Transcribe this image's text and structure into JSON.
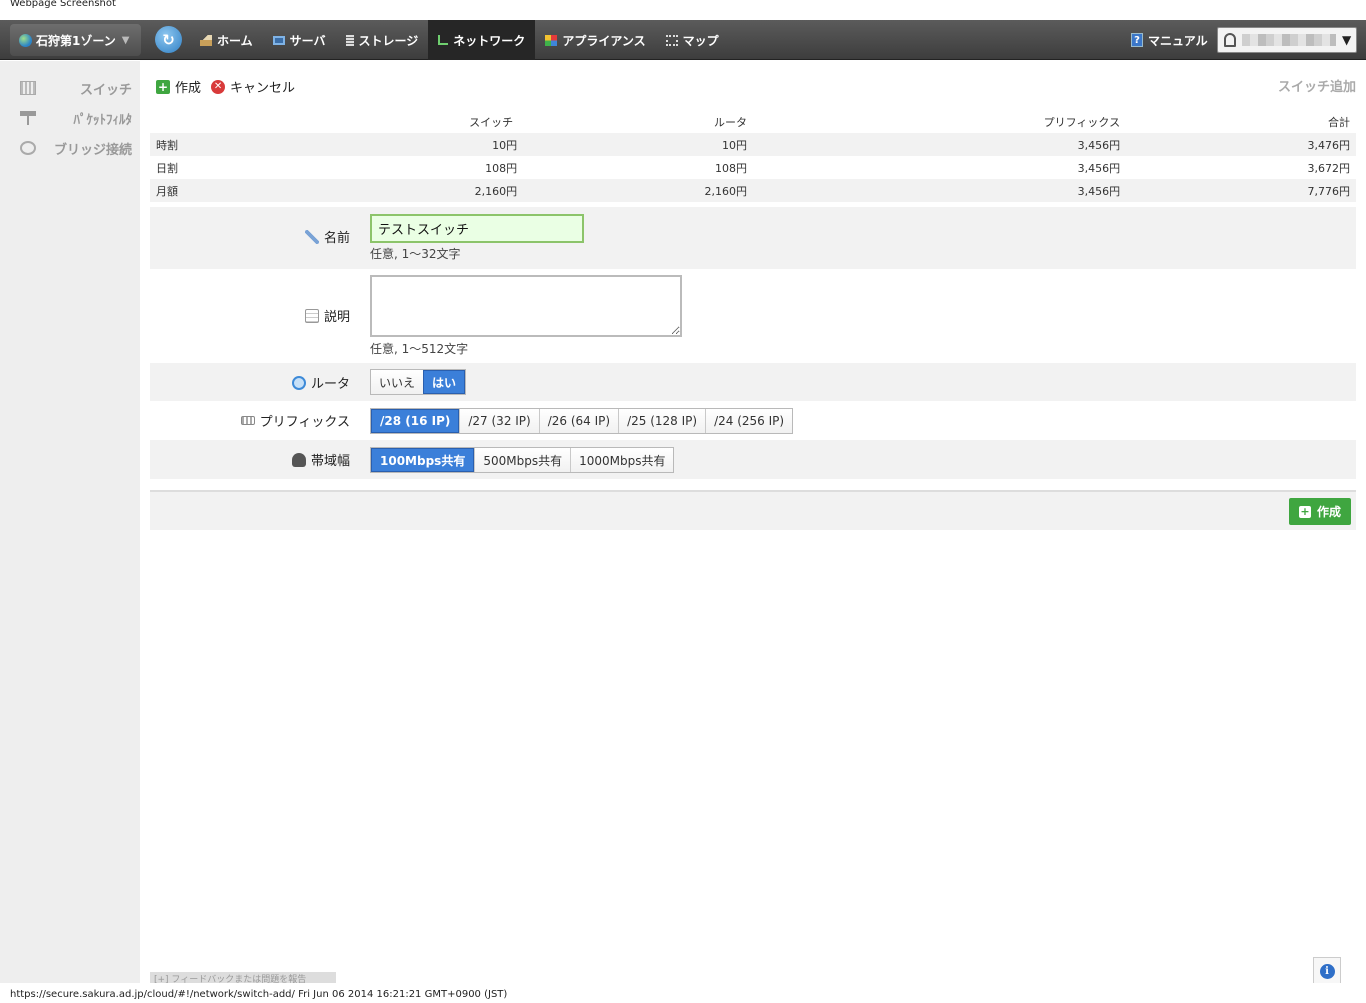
{
  "screenshot_title": "Webpage Screenshot",
  "topbar": {
    "zone_label": "石狩第1ゾーン",
    "nav": [
      {
        "label": "ホーム",
        "icon": "home-icon"
      },
      {
        "label": "サーバ",
        "icon": "server-icon"
      },
      {
        "label": "ストレージ",
        "icon": "storage-icon"
      },
      {
        "label": "ネットワーク",
        "icon": "network-icon",
        "active": true
      },
      {
        "label": "アプライアンス",
        "icon": "appliance-icon"
      },
      {
        "label": "マップ",
        "icon": "map-icon"
      }
    ],
    "manual_label": "マニュアル"
  },
  "sidebar": {
    "items": [
      {
        "label": "スイッチ",
        "icon": "switch-icon"
      },
      {
        "label": "ﾊﾟｹｯﾄﾌｨﾙﾀ",
        "icon": "packet-filter-icon"
      },
      {
        "label": "ブリッジ接続",
        "icon": "bridge-icon"
      }
    ]
  },
  "toolbar": {
    "create_label": "作成",
    "cancel_label": "キャンセル",
    "page_heading": "スイッチ追加"
  },
  "price_table": {
    "headers": [
      "",
      "スイッチ",
      "ルータ",
      "プリフィックス",
      "合計"
    ],
    "rows": [
      [
        "時割",
        "10円",
        "10円",
        "3,456円",
        "3,476円"
      ],
      [
        "日割",
        "108円",
        "108円",
        "3,456円",
        "3,672円"
      ],
      [
        "月額",
        "2,160円",
        "2,160円",
        "3,456円",
        "7,776円"
      ]
    ]
  },
  "form": {
    "name": {
      "label": "名前",
      "value": "テストスイッチ",
      "help": "任意, 1〜32文字"
    },
    "description": {
      "label": "説明",
      "value": "",
      "help": "任意, 1〜512文字"
    },
    "router": {
      "label": "ルータ",
      "options": [
        "いいえ",
        "はい"
      ],
      "selected": "はい"
    },
    "prefix": {
      "label": "プリフィックス",
      "options": [
        "/28 (16 IP)",
        "/27 (32 IP)",
        "/26 (64 IP)",
        "/25 (128 IP)",
        "/24 (256 IP)"
      ],
      "selected": "/28 (16 IP)"
    },
    "bandwidth": {
      "label": "帯域幅",
      "options": [
        "100Mbps共有",
        "500Mbps共有",
        "1000Mbps共有"
      ],
      "selected": "100Mbps共有"
    }
  },
  "footer": {
    "create_label": "作成",
    "feedback_label": "[+] フィードバックまたは問題を報告"
  },
  "status_bar": "https://secure.sakura.ad.jp/cloud/#!/network/switch-add/ Fri Jun 06 2014 16:21:21 GMT+0900 (JST)",
  "colors": {
    "nav_bg": "#4a4a4a",
    "accent_blue": "#3b7fd9",
    "create_green": "#3fa640",
    "input_green": "#eaffe4"
  }
}
